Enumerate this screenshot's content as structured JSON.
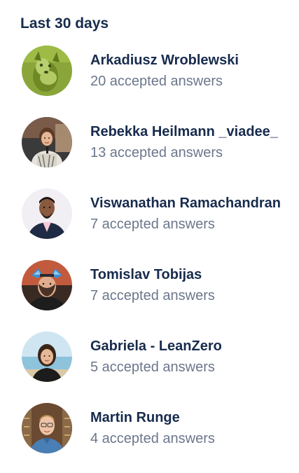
{
  "section": {
    "title": "Last 30 days"
  },
  "leaders": [
    {
      "name": "Arkadiusz Wroblewski",
      "count": "20 accepted answers",
      "avatar": "avatar-arkadiusz"
    },
    {
      "name": "Rebekka Heilmann _viadee_",
      "count": "13 accepted answers",
      "avatar": "avatar-rebekka"
    },
    {
      "name": "Viswanathan Ramachandran",
      "count": "7 accepted answers",
      "avatar": "avatar-viswanathan"
    },
    {
      "name": "Tomislav Tobijas",
      "count": "7 accepted answers",
      "avatar": "avatar-tomislav"
    },
    {
      "name": "Gabriela - LeanZero",
      "count": "5 accepted answers",
      "avatar": "avatar-gabriela"
    },
    {
      "name": "Martin Runge",
      "count": "4 accepted answers",
      "avatar": "avatar-martin"
    }
  ],
  "colors": {
    "name_text": "#172b4d",
    "count_text": "#6b778c",
    "background": "#ffffff"
  }
}
